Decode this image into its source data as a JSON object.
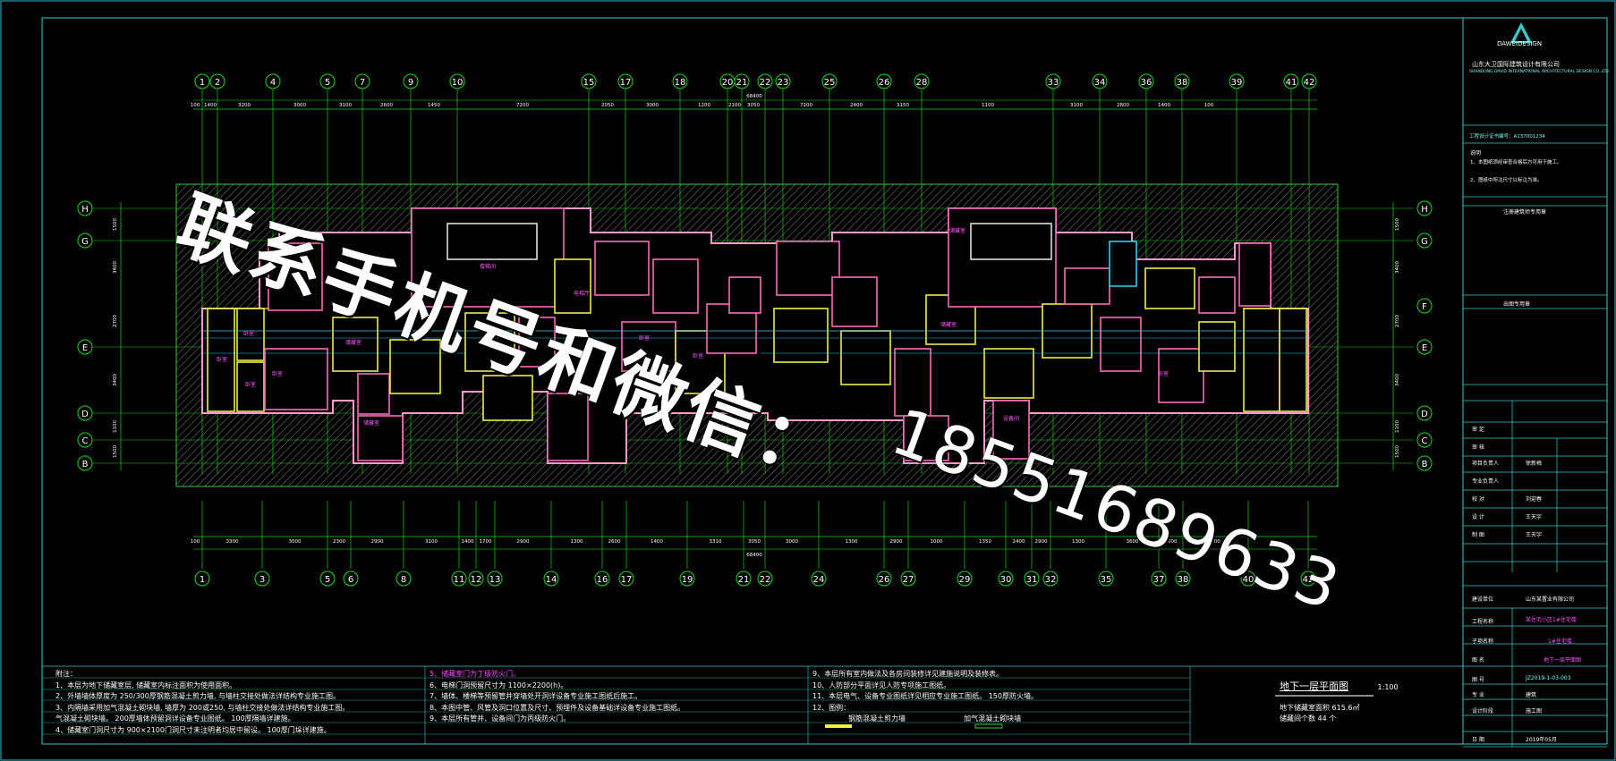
{
  "grid_top": [
    "1",
    "2",
    "4",
    "5",
    "7",
    "9",
    "10",
    "15",
    "17",
    "18",
    "20",
    "21",
    "22",
    "23",
    "25",
    "26",
    "28",
    "33",
    "34",
    "36",
    "38",
    "39",
    "41",
    "42"
  ],
  "grid_bottom": [
    "1",
    "3",
    "5",
    "6",
    "8",
    "11",
    "12",
    "13",
    "14",
    "16",
    "17",
    "19",
    "21",
    "22",
    "24",
    "26",
    "27",
    "29",
    "30",
    "31",
    "32",
    "35",
    "37",
    "38",
    "40",
    "42"
  ],
  "grid_left": [
    "H",
    "G",
    "E",
    "D",
    "C",
    "B"
  ],
  "grid_right": [
    "H",
    "G",
    "F",
    "E",
    "D",
    "C",
    "B"
  ],
  "dims_top": [
    "100",
    "1400",
    "3200",
    "3000",
    "3100",
    "2600",
    "1450",
    "7200",
    "2050",
    "3000",
    "1200",
    "2100",
    "3050",
    "7200",
    "2400",
    "3150",
    "1100",
    "3100",
    "2800",
    "1400",
    "100"
  ],
  "dims_bottom": [
    "100",
    "3300",
    "3000",
    "2300",
    "2900",
    "3100",
    "1400",
    "1700",
    "2900",
    "1300",
    "2600",
    "1400",
    "3310",
    "3050",
    "3000",
    "1300",
    "2900",
    "1000",
    "1350",
    "2400",
    "2900",
    "1300",
    "3600",
    "2000",
    "100"
  ],
  "dims_left": [
    "1500",
    "3400",
    "2700",
    "3400",
    "1100",
    "1500"
  ],
  "dim_total": "68400",
  "watermark_line1": "联系手机号和微信：",
  "watermark_line2": "18551689633",
  "room_labels": [
    "卧室",
    "卧室",
    "电梯间",
    "楼梯间",
    "卧室",
    "卧室",
    "储藏室",
    "储藏室",
    "电梯厅",
    "卧室",
    "卧室",
    "储藏室",
    "设备间",
    "储藏室",
    "卧室"
  ],
  "notes": {
    "heading": "附注：",
    "col1": [
      "1、本层为地下储藏室层, 储藏室内标注面积为使用面积。",
      "2、外墙墙体厚度为 250/300厚钢筋混凝土剪力墙, 与墙柱交接处做法详结构专业施工图。",
      "3、内隔墙采用加气混凝土砌块墙, 墙厚为 200或250, 与墙柱交接处做法详结构专业施工图。",
      "气混凝土砌块墙。 200厚墙体预留洞详设备专业图纸。 100厚隔墙详建施。",
      "4、储藏室门洞尺寸为 900×2100门洞尺寸未注明者均居中留设。 100厚门垛详建施。"
    ],
    "col2": [
      "5、储藏室门为丁级防火门。",
      "6、电梯门洞预留尺寸为 1100×2200(h)。",
      "7、墙体、楼梯等预留管井穿墙处开洞详设备专业施工图纸后施工。",
      "8、本图中管、风管及洞口位置及尺寸、预埋件及设备基础详设备专业施工图纸。",
      "9、本层所有管井、设备间门为丙级防火门。"
    ],
    "col3": [
      "9、本层所有室内做法及各房间装修详见建施说明及装修表。",
      "10、人防部分平面详见人防专项施工图纸。",
      "11、本层电气、设备专业图纸详见相应专业施工图纸。 150厚防火墙。",
      "12、图例："
    ],
    "legend": [
      "钢筋混凝土剪力墙",
      "加气混凝土砌块墙"
    ]
  },
  "drawing_title": {
    "name": "地下一层平面图",
    "scale": "1:100",
    "sub1": "地下储藏室面积 615.6㎡",
    "sub2": "储藏间个数 44 个"
  },
  "title_block": {
    "company": "山东大卫国际建筑设计有限公司",
    "company_en": "SHANDONG DAVID INTERNATIONAL ARCHITECTURAL DESIGN CO.,LTD.",
    "logo_text": "DAWEIDESIGN",
    "qualification": "工程设计证书编号：A137001234",
    "notes_title": "说明",
    "note1": "1、本图纸须经审查合格后方可用于施工。",
    "note2": "2、图纸中所注尺寸以标注为准。",
    "stamp1": "注册建筑师专用章",
    "stamp2": "出图专用章",
    "rows": [
      {
        "label": "审 定",
        "name": ""
      },
      {
        "label": "审 核",
        "name": ""
      },
      {
        "label": "项目负责人",
        "name": "徐新梅"
      },
      {
        "label": "专业负责人",
        "name": ""
      },
      {
        "label": "校 对",
        "name": "刘迎春"
      },
      {
        "label": "设 计",
        "name": "王天宇"
      },
      {
        "label": "制 图",
        "name": "王天宇"
      }
    ],
    "project_label": "建设单位",
    "project": "山东某置业有限公司",
    "project_name_label": "工程名称",
    "project_name": "某住宅小区1#住宅楼",
    "subitem_label": "子项名称",
    "subitem": "1#住宅楼",
    "drawing_label": "图 名",
    "drawing": "地下一层平面图",
    "number_label": "图 号",
    "number": "JZ2019-1-03-003",
    "discipline_label": "专 业",
    "discipline": "建筑",
    "stage_label": "设计阶段",
    "stage": "施工图",
    "date_label": "日 期",
    "date": "2019年05月"
  }
}
